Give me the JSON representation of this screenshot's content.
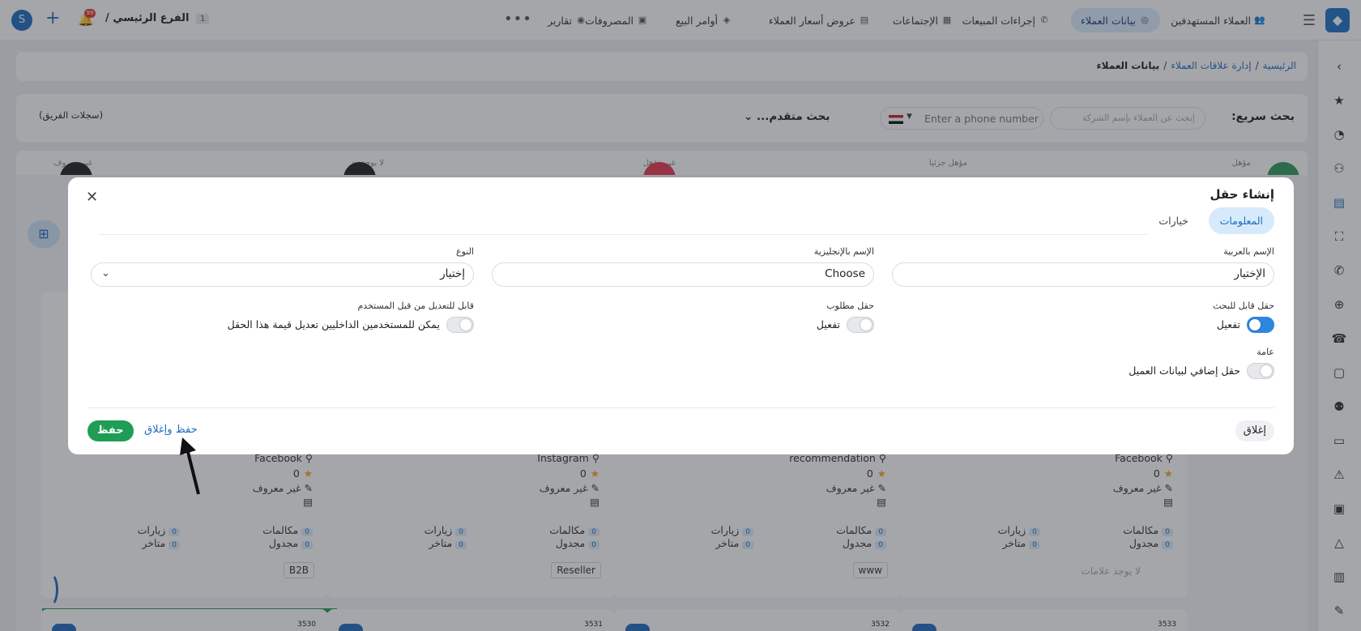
{
  "topbar": {
    "nav": [
      {
        "label": "العملاء المستهدفين",
        "icon": "users-icon"
      },
      {
        "label": "بيانات العملاء",
        "icon": "target-icon",
        "active": true
      },
      {
        "label": "إجراءات المبيعات",
        "icon": "phone-icon"
      },
      {
        "label": "الإجتماعات",
        "icon": "meeting-icon"
      },
      {
        "label": "عروض أسعار العملاء",
        "icon": "quote-icon"
      },
      {
        "label": "أوامر البيع",
        "icon": "bag-icon"
      },
      {
        "label": "المصروفات",
        "icon": "expenses-icon"
      },
      {
        "label": "تقارير",
        "icon": "report-icon"
      }
    ],
    "branch": "الفرع الرئيسي /",
    "branch_num": "1",
    "bell_badge": "99"
  },
  "breadcrumb": {
    "home": "الرئيسية",
    "section": "إدارة علاقات العملاء",
    "current": "بيانات العملاء",
    "sep": "/"
  },
  "search": {
    "label": "بحث سريع:",
    "placeholder": "إبحث عن العملاء بإسم الشركة",
    "phone_placeholder": "Enter a phone number",
    "advanced": "بحث متقدم...",
    "team_records": "(سجلات الفريق)"
  },
  "stats": [
    {
      "label": "مؤهل",
      "color": "#2e9e5b"
    },
    {
      "label": "مؤهل جزئيا",
      "color": "#9aa3ad"
    },
    {
      "label": "غير مؤهل",
      "color": "#e53950"
    },
    {
      "label": "لا يوجد رد",
      "color": "#222222"
    },
    {
      "label": "غير معروف",
      "color": "#222222"
    }
  ],
  "cards": [
    {
      "source": "Facebook",
      "rating": "0",
      "status": "غير معروف",
      "calls_label": "مكالمات",
      "calls": "0",
      "visits_label": "زيارات",
      "visits": "0",
      "scheduled_label": "مجدول",
      "scheduled": "0",
      "late_label": "متاخر",
      "late": "0",
      "tag": "",
      "no_tags": "لا يوجد علامات",
      "id": "3533"
    },
    {
      "source": "recommendation",
      "rating": "0",
      "status": "غير معروف",
      "calls_label": "مكالمات",
      "calls": "0",
      "visits_label": "زيارات",
      "visits": "0",
      "scheduled_label": "مجدول",
      "scheduled": "0",
      "late_label": "متاخر",
      "late": "0",
      "tag": "www",
      "id": "3532"
    },
    {
      "source": "Instagram",
      "rating": "0",
      "status": "غير معروف",
      "calls_label": "مكالمات",
      "calls": "0",
      "visits_label": "زيارات",
      "visits": "0",
      "scheduled_label": "مجدول",
      "scheduled": "0",
      "late_label": "متاخر",
      "late": "0",
      "tag": "Reseller",
      "id": "3531"
    },
    {
      "source": "Facebook",
      "rating": "0",
      "status": "غير معروف",
      "calls_label": "مكالمات",
      "calls": "0",
      "visits_label": "زيارات",
      "visits": "0",
      "scheduled_label": "مجدول",
      "scheduled": "0",
      "late_label": "متاخر",
      "late": "0",
      "tag": "B2B",
      "id": "3530"
    }
  ],
  "left_card": {
    "eg": "EG"
  },
  "modal": {
    "title": "إنشاء حقل",
    "tabs": [
      "المعلومات",
      "خيارات"
    ],
    "fields": {
      "name_ar_label": "الإسم بالعربية",
      "name_ar_value": "الإختيار",
      "name_en_label": "الإسم بالإنجليزية",
      "name_en_value": "Choose",
      "type_label": "النوع",
      "type_value": "إختيار"
    },
    "toggles": {
      "searchable_label": "حقل قابل للبحث",
      "searchable_text": "تفعيل",
      "searchable_on": true,
      "required_label": "حقل مطلوب",
      "required_text": "تفعيل",
      "required_on": false,
      "editable_label": "قابل للتعديل من قبل المستخدم",
      "editable_text": "يمكن للمستخدمين الداخليين تعديل قيمة هذا الحقل",
      "editable_on": false,
      "general_label": "عامة",
      "general_text": "حقل إضافي لبيانات العميل",
      "general_on": false
    },
    "buttons": {
      "close": "إغلاق",
      "save": "حفظ",
      "save_close": "حفظ وإغلاق"
    }
  }
}
